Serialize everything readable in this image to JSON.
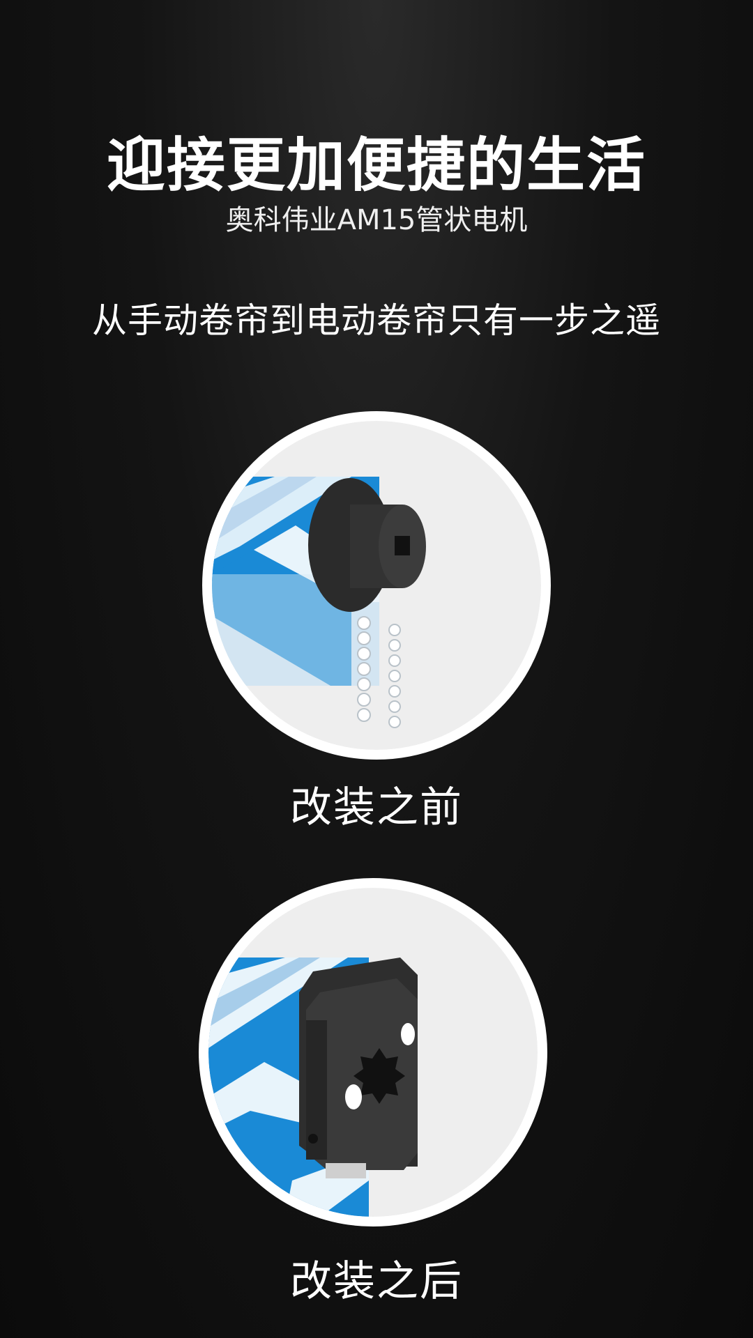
{
  "header": {
    "headline": "迎接更加便捷的生活",
    "subtitle": "奥科伟业AM15管状电机",
    "tagline": "从手动卷帘到电动卷帘只有一步之遥"
  },
  "comparison": {
    "before_caption": "改装之前",
    "after_caption": "改装之后"
  },
  "colors": {
    "background": "#0b0b0b",
    "accent_blue": "#1a8ad6",
    "text": "#ffffff"
  }
}
